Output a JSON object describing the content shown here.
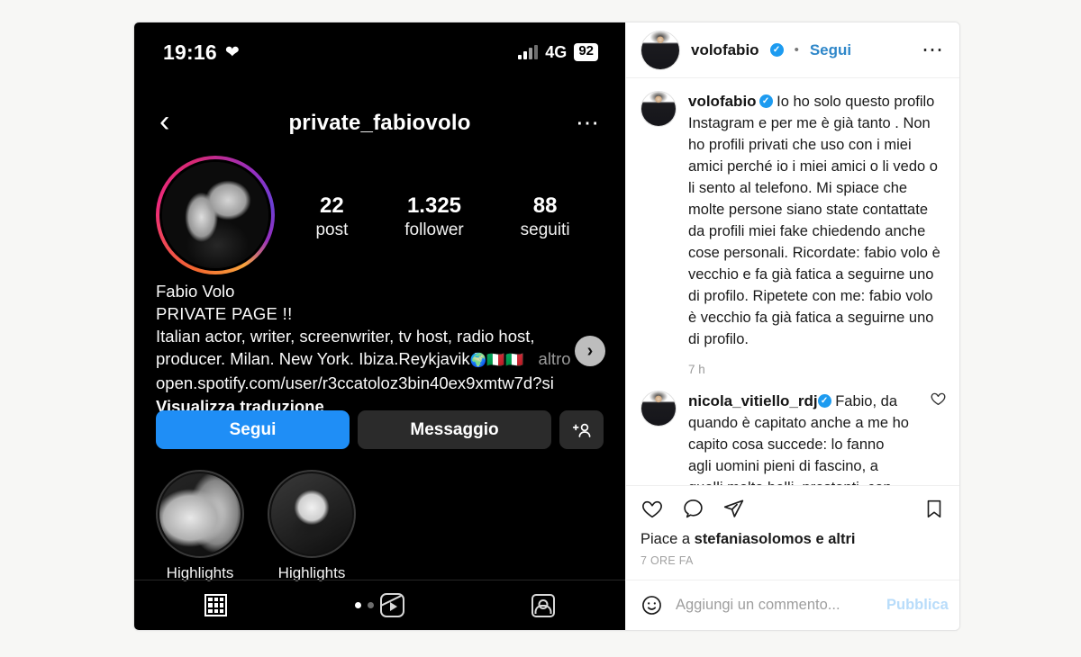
{
  "phone": {
    "statusbar": {
      "time": "19:16",
      "heart_icon": "heart-icon",
      "signal_icon": "signal-bars-icon",
      "network": "4G",
      "battery": "92"
    },
    "nav": {
      "back_icon": "back-chevron-icon",
      "title": "private_fabiovolo",
      "menu_icon": "more-options-icon"
    },
    "profile": {
      "avatar_icon": "profile-avatar",
      "stats": [
        {
          "num": "22",
          "label": "post"
        },
        {
          "num": "1.325",
          "label": "follower"
        },
        {
          "num": "88",
          "label": "seguiti"
        }
      ]
    },
    "bio": {
      "name": "Fabio Volo",
      "private_page": "PRIVATE PAGE !!",
      "description_line1": "Italian actor, writer, screenwriter, tv host, radio host,",
      "description_line2": "producer. Milan. New York. Ibiza.Reykjavik",
      "globe": "🌍",
      "flag1": "🇮🇹",
      "flag2": "🇮🇹",
      "more": "altro",
      "link": "open.spotify.com/user/r3ccatoloz3bin40ex9xmtw7d?si",
      "translate": "Visualizza traduzione",
      "chevron_icon": "chevron-right-icon"
    },
    "buttons": {
      "follow": "Segui",
      "message": "Messaggio",
      "adduser_icon": "add-user-icon"
    },
    "highlights": [
      {
        "label": "Highlights"
      },
      {
        "label": "Highlights"
      }
    ],
    "tabs": [
      {
        "icon": "grid-icon"
      },
      {
        "icon": "reels-icon"
      },
      {
        "icon": "tagged-icon"
      }
    ]
  },
  "post": {
    "header": {
      "avatar_icon": "author-avatar",
      "username": "volofabio",
      "verified_icon": "verified-badge-icon",
      "separator": "•",
      "follow_label": "Segui",
      "menu_icon": "more-options-icon"
    },
    "caption": {
      "avatar_icon": "author-avatar",
      "username": "volofabio",
      "verified_icon": "verified-badge-icon",
      "text": "Io ho solo questo profilo Instagram e per me è già tanto . Non ho profili privati che uso con i miei amici perché io i miei amici o li vedo o li sento al telefono. Mi spiace che molte persone siano state contattate da profili miei fake chiedendo anche cose personali. Ricordate: fabio volo è vecchio e fa già fatica a seguirne uno di profilo. Ripetete con me: fabio volo è vecchio fa già fatica a seguirne uno di profilo.",
      "time": "7 h"
    },
    "comment": {
      "avatar_icon": "commenter-avatar",
      "username": "nicola_vitiello_rdj",
      "verified_icon": "verified-badge-icon",
      "text": "Fabio, da quando è capitato anche a me ho capito cosa succede: lo fanno agli uomini pieni di fascino, a quelli molto belli, prestanti, con una",
      "like_icon": "heart-icon"
    },
    "actions": {
      "like_icon": "heart-icon",
      "comment_icon": "comment-bubble-icon",
      "share_icon": "share-paperplane-icon",
      "save_icon": "bookmark-icon"
    },
    "likes": {
      "prefix": "Piace a",
      "user": "stefaniasolomos",
      "suffix": "e altri"
    },
    "age": "7 ORE FA",
    "addcomment": {
      "emoji_icon": "emoji-smiley-icon",
      "placeholder": "Aggiungi un commento...",
      "value": "",
      "publish_label": "Pubblica"
    }
  },
  "colors": {
    "page_bg": "#f7f7f5",
    "accent_blue": "#1f8ef6",
    "link_blue": "#2f87c9",
    "publish_blue": "#b8dcfa",
    "verified_blue": "#1d9bf0",
    "phone_bg": "#000000"
  }
}
